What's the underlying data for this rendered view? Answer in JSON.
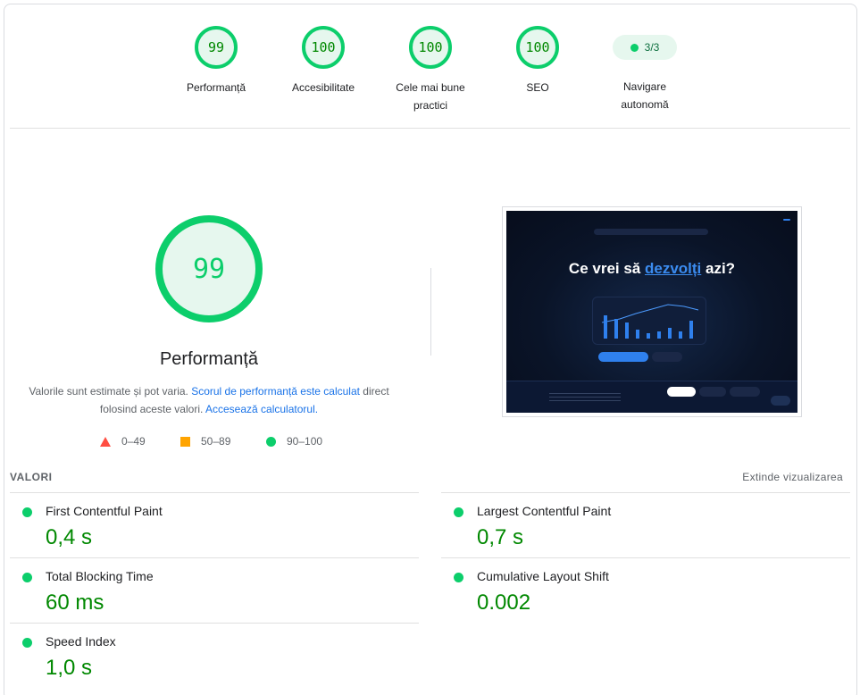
{
  "gauges": [
    {
      "score": "99",
      "label": "Performanță"
    },
    {
      "score": "100",
      "label": "Accesibilitate"
    },
    {
      "score": "100",
      "label": "Cele mai bune practici"
    },
    {
      "score": "100",
      "label": "SEO"
    }
  ],
  "autonomous": {
    "value": "3/3",
    "label": "Navigare autonomă"
  },
  "main": {
    "score": "99",
    "title": "Performanță",
    "desc_prefix": "Valorile sunt estimate și pot varia. ",
    "desc_link1": "Scorul de performanță este calculat",
    "desc_middle": " direct folosind aceste valori. ",
    "desc_link2": "Accesează calculatorul."
  },
  "legend": [
    {
      "range": "0–49",
      "color": "#ff4e42"
    },
    {
      "range": "50–89",
      "color": "#ffa400"
    },
    {
      "range": "90–100",
      "color": "#0cce6b"
    }
  ],
  "screenshot": {
    "hero_prefix": "Ce vrei să ",
    "hero_highlight": "dezvolți",
    "hero_suffix": " azi?"
  },
  "metrics_section": {
    "heading": "VALORI",
    "expand_label": "Extinde vizualizarea"
  },
  "metrics": [
    {
      "name": "First Contentful Paint",
      "value": "0,4 s"
    },
    {
      "name": "Largest Contentful Paint",
      "value": "0,7 s"
    },
    {
      "name": "Total Blocking Time",
      "value": "60 ms"
    },
    {
      "name": "Cumulative Layout Shift",
      "value": "0.002"
    },
    {
      "name": "Speed Index",
      "value": "1,0 s"
    }
  ],
  "colors": {
    "pass": "#0cce6b",
    "pass_text": "#008800",
    "link": "#1a73e8"
  }
}
